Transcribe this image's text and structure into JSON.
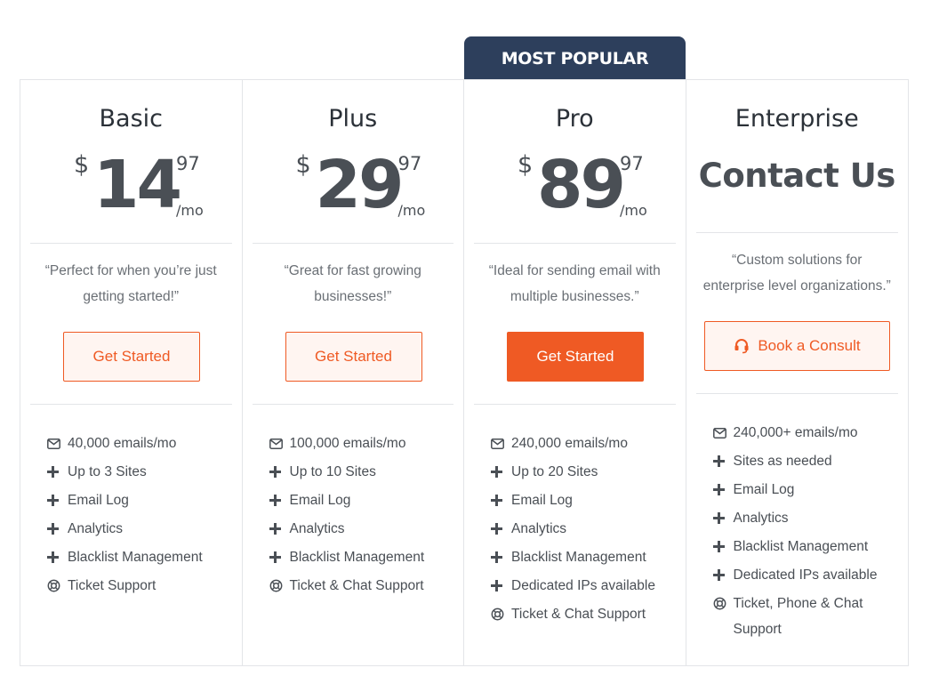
{
  "badge": "MOST POPULAR",
  "plans": [
    {
      "name": "Basic",
      "currency": "$",
      "price": "14",
      "cents": "97",
      "period": "/mo",
      "tagline": "“Perfect for when you’re just getting started!”",
      "button": "Get Started",
      "features": [
        {
          "icon": "envelope-icon",
          "text": "40,000 emails/mo"
        },
        {
          "icon": "plus-icon",
          "text": "Up to 3 Sites"
        },
        {
          "icon": "plus-icon",
          "text": "Email Log"
        },
        {
          "icon": "plus-icon",
          "text": "Analytics"
        },
        {
          "icon": "plus-icon",
          "text": "Blacklist Management"
        },
        {
          "icon": "lifebuoy-icon",
          "text": "Ticket Support"
        }
      ]
    },
    {
      "name": "Plus",
      "currency": "$",
      "price": "29",
      "cents": "97",
      "period": "/mo",
      "tagline": "“Great for fast growing businesses!”",
      "button": "Get Started",
      "features": [
        {
          "icon": "envelope-icon",
          "text": "100,000 emails/mo"
        },
        {
          "icon": "plus-icon",
          "text": "Up to 10 Sites"
        },
        {
          "icon": "plus-icon",
          "text": "Email Log"
        },
        {
          "icon": "plus-icon",
          "text": "Analytics"
        },
        {
          "icon": "plus-icon",
          "text": "Blacklist Management"
        },
        {
          "icon": "lifebuoy-icon",
          "text": "Ticket & Chat Support"
        }
      ]
    },
    {
      "name": "Pro",
      "currency": "$",
      "price": "89",
      "cents": "97",
      "period": "/mo",
      "tagline": "“Ideal for sending email with multiple businesses.”",
      "button": "Get Started",
      "features": [
        {
          "icon": "envelope-icon",
          "text": "240,000 emails/mo"
        },
        {
          "icon": "plus-icon",
          "text": "Up to 20 Sites"
        },
        {
          "icon": "plus-icon",
          "text": "Email Log"
        },
        {
          "icon": "plus-icon",
          "text": "Analytics"
        },
        {
          "icon": "plus-icon",
          "text": "Blacklist Management"
        },
        {
          "icon": "plus-icon",
          "text": "Dedicated IPs available"
        },
        {
          "icon": "lifebuoy-icon",
          "text": "Ticket & Chat Support"
        }
      ]
    },
    {
      "name": "Enterprise",
      "contact": "Contact Us",
      "tagline": "“Custom solutions for enterprise level organizations.”",
      "button": "Book a Consult",
      "button_icon": "headset-icon",
      "features": [
        {
          "icon": "envelope-icon",
          "text": "240,000+ emails/mo"
        },
        {
          "icon": "plus-icon",
          "text": "Sites as needed"
        },
        {
          "icon": "plus-icon",
          "text": "Email Log"
        },
        {
          "icon": "plus-icon",
          "text": "Analytics"
        },
        {
          "icon": "plus-icon",
          "text": "Blacklist Management"
        },
        {
          "icon": "plus-icon",
          "text": "Dedicated IPs available"
        },
        {
          "icon": "lifebuoy-icon",
          "text": "Ticket, Phone & Chat Support"
        }
      ]
    }
  ],
  "colors": {
    "accent": "#ef5a24",
    "badge_bg": "#2d3f5c",
    "border": "#e3e5e8",
    "text": "#4a4f55"
  }
}
